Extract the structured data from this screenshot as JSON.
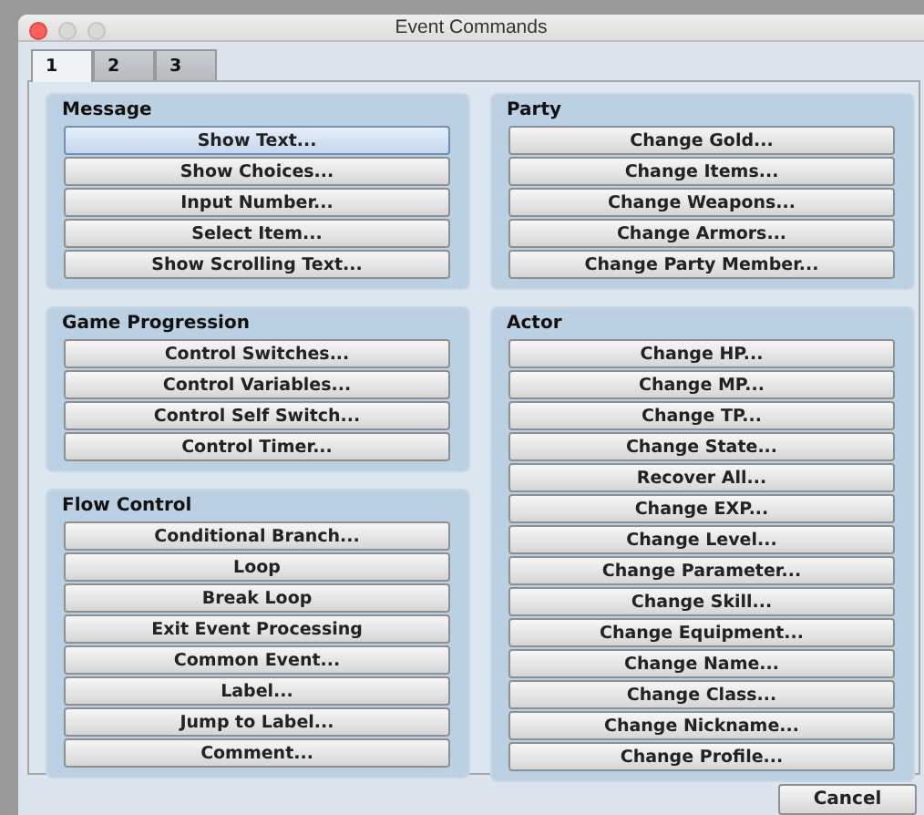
{
  "window": {
    "title": "Event Commands"
  },
  "tabs": [
    {
      "label": "1",
      "selected": true
    },
    {
      "label": "2",
      "selected": false
    },
    {
      "label": "3",
      "selected": false
    }
  ],
  "columns": [
    [
      {
        "title": "Message",
        "buttons": [
          {
            "label": "Show Text...",
            "selected": true
          },
          {
            "label": "Show Choices...",
            "selected": false
          },
          {
            "label": "Input Number...",
            "selected": false
          },
          {
            "label": "Select Item...",
            "selected": false
          },
          {
            "label": "Show Scrolling Text...",
            "selected": false
          }
        ]
      },
      {
        "title": "Game Progression",
        "buttons": [
          {
            "label": "Control Switches...",
            "selected": false
          },
          {
            "label": "Control Variables...",
            "selected": false
          },
          {
            "label": "Control Self Switch...",
            "selected": false
          },
          {
            "label": "Control Timer...",
            "selected": false
          }
        ]
      },
      {
        "title": "Flow Control",
        "buttons": [
          {
            "label": "Conditional Branch...",
            "selected": false
          },
          {
            "label": "Loop",
            "selected": false
          },
          {
            "label": "Break Loop",
            "selected": false
          },
          {
            "label": "Exit Event Processing",
            "selected": false
          },
          {
            "label": "Common Event...",
            "selected": false
          },
          {
            "label": "Label...",
            "selected": false
          },
          {
            "label": "Jump to Label...",
            "selected": false
          },
          {
            "label": "Comment...",
            "selected": false
          }
        ]
      }
    ],
    [
      {
        "title": "Party",
        "buttons": [
          {
            "label": "Change Gold...",
            "selected": false
          },
          {
            "label": "Change Items...",
            "selected": false
          },
          {
            "label": "Change Weapons...",
            "selected": false
          },
          {
            "label": "Change Armors...",
            "selected": false
          },
          {
            "label": "Change Party Member...",
            "selected": false
          }
        ]
      },
      {
        "title": "Actor",
        "buttons": [
          {
            "label": "Change HP...",
            "selected": false
          },
          {
            "label": "Change MP...",
            "selected": false
          },
          {
            "label": "Change TP...",
            "selected": false
          },
          {
            "label": "Change State...",
            "selected": false
          },
          {
            "label": "Recover All...",
            "selected": false
          },
          {
            "label": "Change EXP...",
            "selected": false
          },
          {
            "label": "Change Level...",
            "selected": false
          },
          {
            "label": "Change Parameter...",
            "selected": false
          },
          {
            "label": "Change Skill...",
            "selected": false
          },
          {
            "label": "Change Equipment...",
            "selected": false
          },
          {
            "label": "Change Name...",
            "selected": false
          },
          {
            "label": "Change Class...",
            "selected": false
          },
          {
            "label": "Change Nickname...",
            "selected": false
          },
          {
            "label": "Change Profile...",
            "selected": false
          }
        ]
      }
    ]
  ],
  "footer": {
    "buttons": [
      "Cancel"
    ]
  }
}
